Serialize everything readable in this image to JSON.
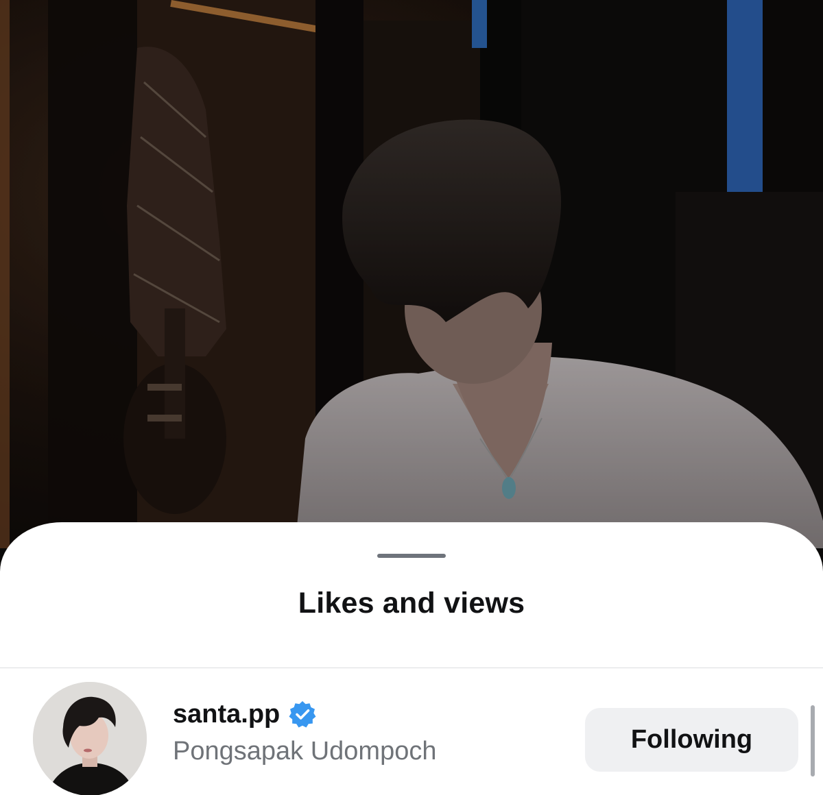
{
  "sheet": {
    "title": "Likes and views"
  },
  "user": {
    "username": "santa.pp",
    "full_name": "Pongsapak Udompoch",
    "verified": true,
    "follow_button_label": "Following"
  },
  "colors": {
    "verified_badge": "#3897f0",
    "sheet_background": "#ffffff",
    "button_background": "#eff0f2",
    "secondary_text": "#6f7378"
  },
  "icons": {
    "verified": "verified-badge-icon"
  }
}
